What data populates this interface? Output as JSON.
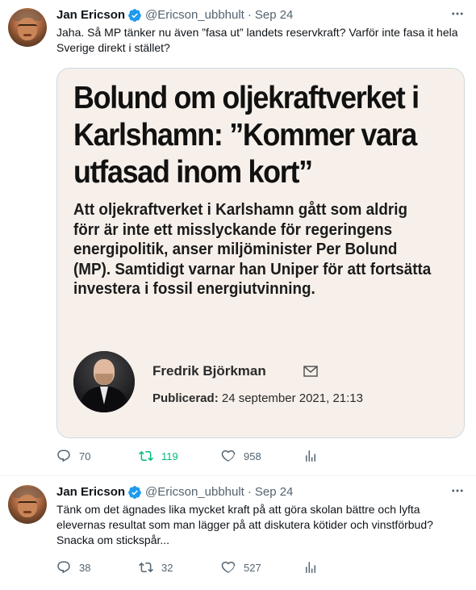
{
  "tweets": [
    {
      "author": {
        "name": "Jan Ericson",
        "handle": "@Ericson_ubbhult",
        "separator": "·",
        "date": "Sep 24",
        "verified": true
      },
      "text": "Jaha. Så MP tänker nu även ”fasa ut” landets reservkraft? Varför inte fasa it hela Sverige direkt i stället?",
      "card": {
        "title": "Bolund om oljekraftverket i Karlshamn: ”Kommer vara utfasad inom kort”",
        "lead": "Att oljekraftverket i Karlshamn gått som aldrig förr är inte ett misslyckande för regeringens energipolitik, anser miljöminister Per Bolund (MP). Samtidigt varnar han Uniper för att fortsätta investera i fossil energiutvinning.",
        "author_name": "Fredrik Björkman",
        "published_label": "Publicerad:",
        "published_date": "24 september 2021, 21:13"
      },
      "stats": {
        "replies": "70",
        "retweets": "119",
        "likes": "958"
      }
    },
    {
      "author": {
        "name": "Jan Ericson",
        "handle": "@Ericson_ubbhult",
        "separator": "·",
        "date": "Sep 24",
        "verified": true
      },
      "text": "Tänk om det ägnades lika mycket kraft på att göra skolan bättre och lyfta elevernas resultat som man lägger på att diskutera kötider och vinstförbud? Snacka om stickspår...",
      "stats": {
        "replies": "38",
        "retweets": "32",
        "likes": "527"
      }
    }
  ],
  "icons": {
    "more": "more-icon",
    "verified": "verified-badge-icon",
    "reply": "reply-icon",
    "retweet": "retweet-icon",
    "like": "like-icon",
    "analytics": "analytics-icon",
    "mail": "mail-icon"
  },
  "colors": {
    "verified": "#1d9bf0",
    "retweet_active": "#00ba7c",
    "secondary_text": "#536471",
    "card_background": "#f7f0ea"
  }
}
